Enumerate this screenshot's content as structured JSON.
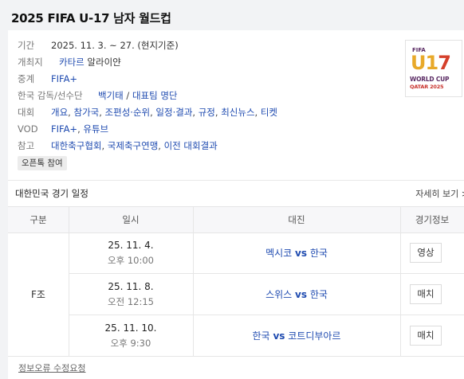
{
  "page": {
    "title": "2025 FIFA U-17 남자 월드컵"
  },
  "info": {
    "period": {
      "label": "기간",
      "value": "2025. 11. 3. ~ 27. (현지기준)"
    },
    "host": {
      "label": "개최지",
      "country": "카타르",
      "city": "알라이얀"
    },
    "broadcast": {
      "label": "중계",
      "value": "FIFA+"
    },
    "coach": {
      "label": "한국 감독/선수단",
      "coach": "백기태",
      "sep": "/",
      "roster": "대표팀 명단"
    },
    "tournament": {
      "label": "대회",
      "links": [
        "개요",
        "참가국",
        "조편성·순위",
        "일정·결과",
        "규정",
        "최신뉴스",
        "티켓"
      ]
    },
    "vod": {
      "label": "VOD",
      "links": [
        "FIFA+",
        "유튜브"
      ]
    },
    "reference": {
      "label": "참고",
      "links": [
        "대한축구협회",
        "국제축구연맹",
        "이전 대회결과"
      ]
    },
    "open_chat": "오픈톡 참여"
  },
  "logo": {
    "line1": "FIFA",
    "line2a": "U1",
    "line2b": "7",
    "line3": "WORLD CUP",
    "line4": "QATAR 2025",
    "name": "fifa-u17-world-cup-logo"
  },
  "schedule": {
    "title": "대한민국 경기 일정",
    "more": "자세히 보기 >",
    "headers": [
      "구분",
      "일시",
      "대진",
      "경기정보"
    ],
    "group": "F조",
    "matches": [
      {
        "date": "25. 11. 4.",
        "time": "오후 10:00",
        "home": "멕시코",
        "vs": "vs",
        "away": "한국",
        "action": "영상"
      },
      {
        "date": "25. 11. 8.",
        "time": "오전 12:15",
        "home": "스위스",
        "vs": "vs",
        "away": "한국",
        "action": "매치"
      },
      {
        "date": "25. 11. 10.",
        "time": "오후 9:30",
        "home": "한국",
        "vs": "vs",
        "away": "코트디부아르",
        "action": "매치"
      }
    ]
  },
  "footer": {
    "report": "정보오류 수정요청"
  },
  "colors": {
    "link": "#1f4bb0",
    "background": "#f2f3f5"
  }
}
